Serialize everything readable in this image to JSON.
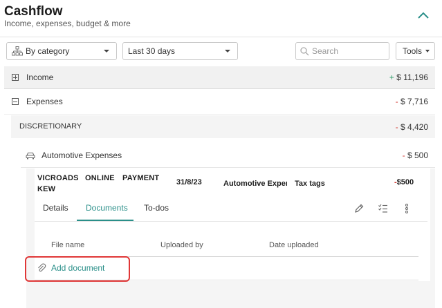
{
  "header": {
    "title": "Cashflow",
    "subtitle": "Income, expenses, budget & more"
  },
  "toolbar": {
    "group_by": "By category",
    "date_range": "Last 30 days",
    "search_placeholder": "Search",
    "tools_label": "Tools"
  },
  "rows": {
    "income": {
      "label": "Income",
      "sign": "+",
      "amount": "$ 11,196"
    },
    "expenses": {
      "label": "Expenses",
      "sign": "-",
      "amount": "$ 7,716"
    },
    "discretionary": {
      "label": "DISCRETIONARY",
      "sign": "-",
      "amount": "$ 4,420"
    },
    "automotive": {
      "label": "Automotive Expenses",
      "sign": "-",
      "amount": "$ 500"
    }
  },
  "transaction": {
    "payee_line1": [
      "VICROADS",
      "ONLINE",
      "PAYMENT"
    ],
    "payee_line2": "KEW",
    "date": "31/8/23",
    "category": "Automotive Exper",
    "tags": "Tax tags",
    "sign": "-",
    "amount": "$500"
  },
  "tabs": [
    {
      "label": "Details"
    },
    {
      "label": "Documents"
    },
    {
      "label": "To-dos"
    }
  ],
  "documents": {
    "columns": [
      "File name",
      "Uploaded by",
      "Date uploaded"
    ],
    "add_label": "Add document"
  },
  "colors": {
    "accent": "#2a8f89",
    "positive": "#2e9c6a",
    "negative": "#d0342c",
    "highlight": "#e03737"
  }
}
